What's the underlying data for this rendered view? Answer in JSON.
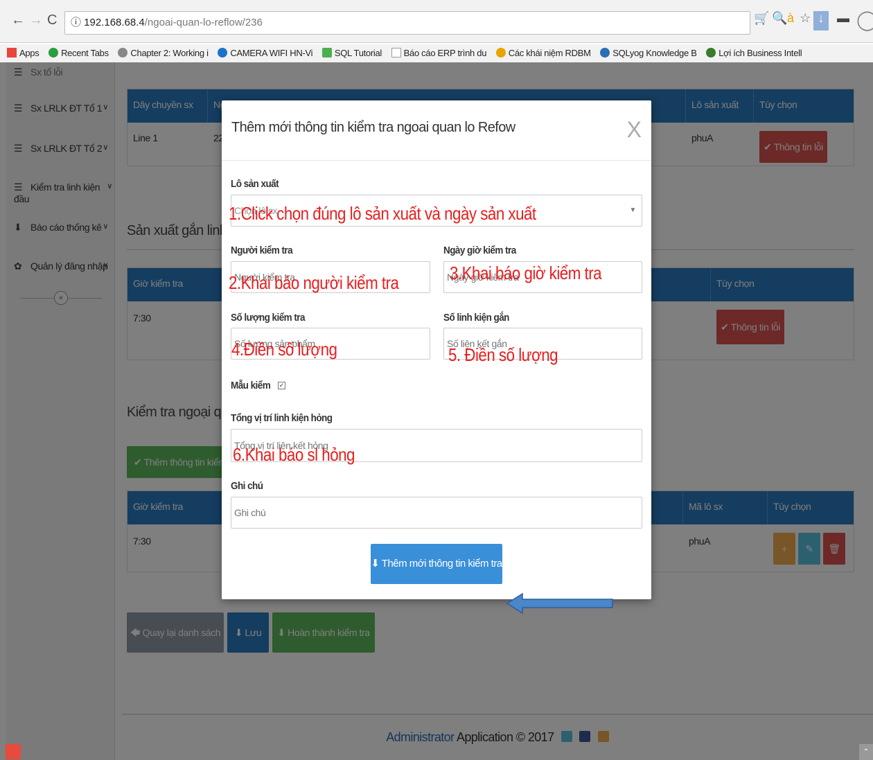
{
  "browser": {
    "url_host": "192.168.68.4",
    "url_path": "/ngoai-quan-lo-reflow/236",
    "bookmarks": [
      {
        "label": "Apps",
        "color": "#e8453c"
      },
      {
        "label": "Recent Tabs",
        "color": "#2a9d3f"
      },
      {
        "label": "Chapter 2: Working i",
        "color": "#888888"
      },
      {
        "label": "CAMERA WIFI HN-Vi",
        "color": "#1a73c8"
      },
      {
        "label": "SQL Tutorial",
        "color": "#4caf50"
      },
      {
        "label": "Báo cáo ERP trình du",
        "color": "#cccccc"
      },
      {
        "label": "Các khái niệm RDBM",
        "color": "#e8a400"
      },
      {
        "label": "SQLyog Knowledge B",
        "color": "#2a6eb3"
      },
      {
        "label": "Lợi ích Business Intell",
        "color": "#3a7b2c"
      }
    ]
  },
  "sidebar": {
    "items": [
      {
        "label": "Sx LRLK ĐT Tổ 1"
      },
      {
        "label": "Sx LRLK ĐT Tổ 2"
      },
      {
        "label": "Kiểm tra linh kiện đầu"
      },
      {
        "label": "Báo cáo thống kê"
      },
      {
        "label": "Quản lý đăng nhập"
      }
    ]
  },
  "table1": {
    "headers": [
      "Dây chuyền sx",
      "Ng",
      "Lô sản xuất",
      "Tùy chọn"
    ],
    "row": {
      "line": "Line 1",
      "ng": "22",
      "lot": "phuA"
    },
    "action": "Thông tin lỗi"
  },
  "section2": {
    "title": "Sản xuất gắn linh kiệ",
    "headers": [
      "Giờ kiểm tra",
      "Tùy chọn"
    ],
    "row_time": "7:30",
    "action": "Thông tin lỗi"
  },
  "section3": {
    "title": "Kiểm tra ngoại quan",
    "add_button": "Thêm thông tin kiểm tra",
    "headers": [
      "Giờ kiểm tra",
      "Mã lô sx",
      "Tùy chọn"
    ],
    "row_time": "7:30",
    "row_lot": "phuA"
  },
  "bottom_buttons": {
    "back": "Quay lại danh sách",
    "save": "Lưu",
    "complete": "Hoàn thành kiểm tra"
  },
  "footer": {
    "brand": "Administrator",
    "rest": "Application © 2017"
  },
  "modal": {
    "title": "Thêm mới thông tin kiểm tra ngoai quan lo Refow",
    "close": "X",
    "lot_label": "Lô sản xuất",
    "lot_placeholder": "Chọn lô sx",
    "inspector_label": "Người kiểm tra",
    "inspector_placeholder": "Người kiểm tra",
    "datetime_label": "Ngày giờ kiểm tra",
    "datetime_placeholder": "Ngày giờ kiểm tra",
    "qty_label": "Số lượng kiểm tra",
    "qty_placeholder": "Số lượng sản phẩm",
    "parts_label": "Số linh kiện gắn",
    "parts_placeholder": "Số liện kết gắn",
    "sample_label": "Mẫu kiểm",
    "defect_label": "Tổng vị trí linh kiện hỏng",
    "defect_placeholder": "Tổng vị trí liện kết hỏng",
    "note_label": "Ghi chú",
    "note_placeholder": "Ghi chú",
    "submit": "Thêm mới thông tin kiểm tra"
  },
  "annotations": {
    "step1": "1.Click chọn đúng lô sản xuất và ngày sản xuất",
    "step2": "2.Khai báo người kiểm tra",
    "step3": "3.Khai báo giờ kiểm tra",
    "step4": "4.Điền số lượng",
    "step5": "5. Điền số lượng",
    "step6": "6.Khai báo sl hỏng"
  }
}
